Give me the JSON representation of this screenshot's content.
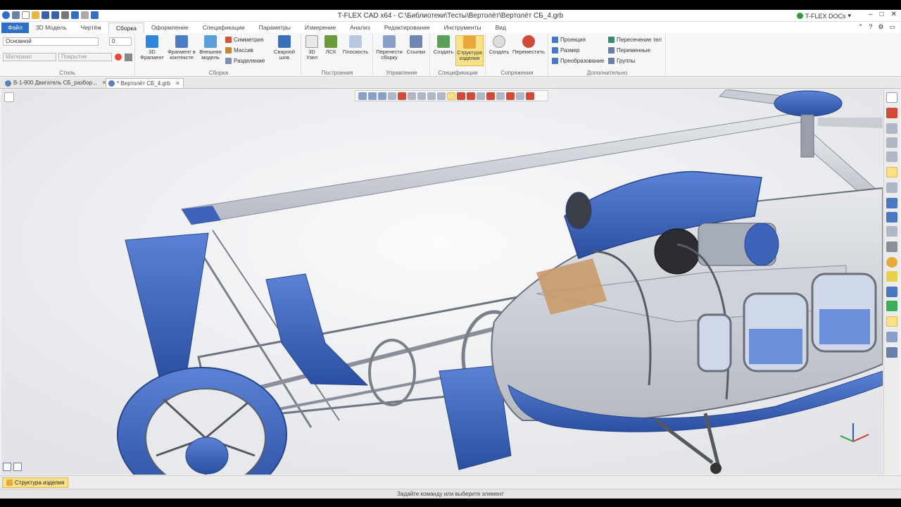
{
  "window": {
    "title": "T-FLEX CAD x64 - C:\\Библиотеки\\Тесты\\Вертолёт\\Вертолёт СБ_4.grb",
    "tflex_docs": "T-FLEX DOCs",
    "minimize": "–",
    "maximize": "□",
    "close": "✕"
  },
  "tabs": [
    "Файл",
    "3D Модель",
    "Чертёж",
    "Сборка",
    "Оформление",
    "Спецификации",
    "Параметры",
    "Измерение",
    "Анализ",
    "Редактирование",
    "Инструменты",
    "Вид"
  ],
  "ribbon": {
    "style": {
      "label": "Стиль",
      "layer_value": "Основной",
      "level_value": "0",
      "material_placeholder": "Материал",
      "coating_placeholder": "Покрытие"
    },
    "assembly": {
      "label": "Сборка",
      "fragment_3d": "3D Фрагмент",
      "fragment_context": "Фрагмент в контексте",
      "external_model": "Внешняя модель",
      "symmetry": "Симметрия",
      "array": "Массив",
      "split": "Разделение",
      "weld": "Сварной шов"
    },
    "constructions": {
      "label": "Построения",
      "node_3d": "3D Узел",
      "lcs": "ЛСК",
      "plane": "Плоскость"
    },
    "management": {
      "label": "Управление",
      "rebuild": "Перенести сборку",
      "links": "Ссылки"
    },
    "specifications": {
      "label": "Спецификации",
      "create": "Создать",
      "structure": "Структура изделия"
    },
    "mates": {
      "label": "Сопряжения",
      "create": "Создать",
      "move": "Переместить"
    },
    "extra": {
      "label": "Дополнительно",
      "projection": "Проекция",
      "size": "Размер",
      "transform": "Преобразование",
      "body_intersection": "Пересечение тел",
      "variables": "Переменные",
      "groups": "Группы"
    }
  },
  "documents": [
    {
      "name": "В-1-900 Двигатель СБ_разбор...",
      "active": false
    },
    {
      "name": "* Вертолёт СБ_4.grb",
      "active": true
    }
  ],
  "bottom_tab": "Структура изделия",
  "status": "Задайте команду или выберите элемент",
  "colors": {
    "accent": "#2f6fc5",
    "body_blue": "#3d63b8",
    "highlight": "#fbe08a"
  }
}
